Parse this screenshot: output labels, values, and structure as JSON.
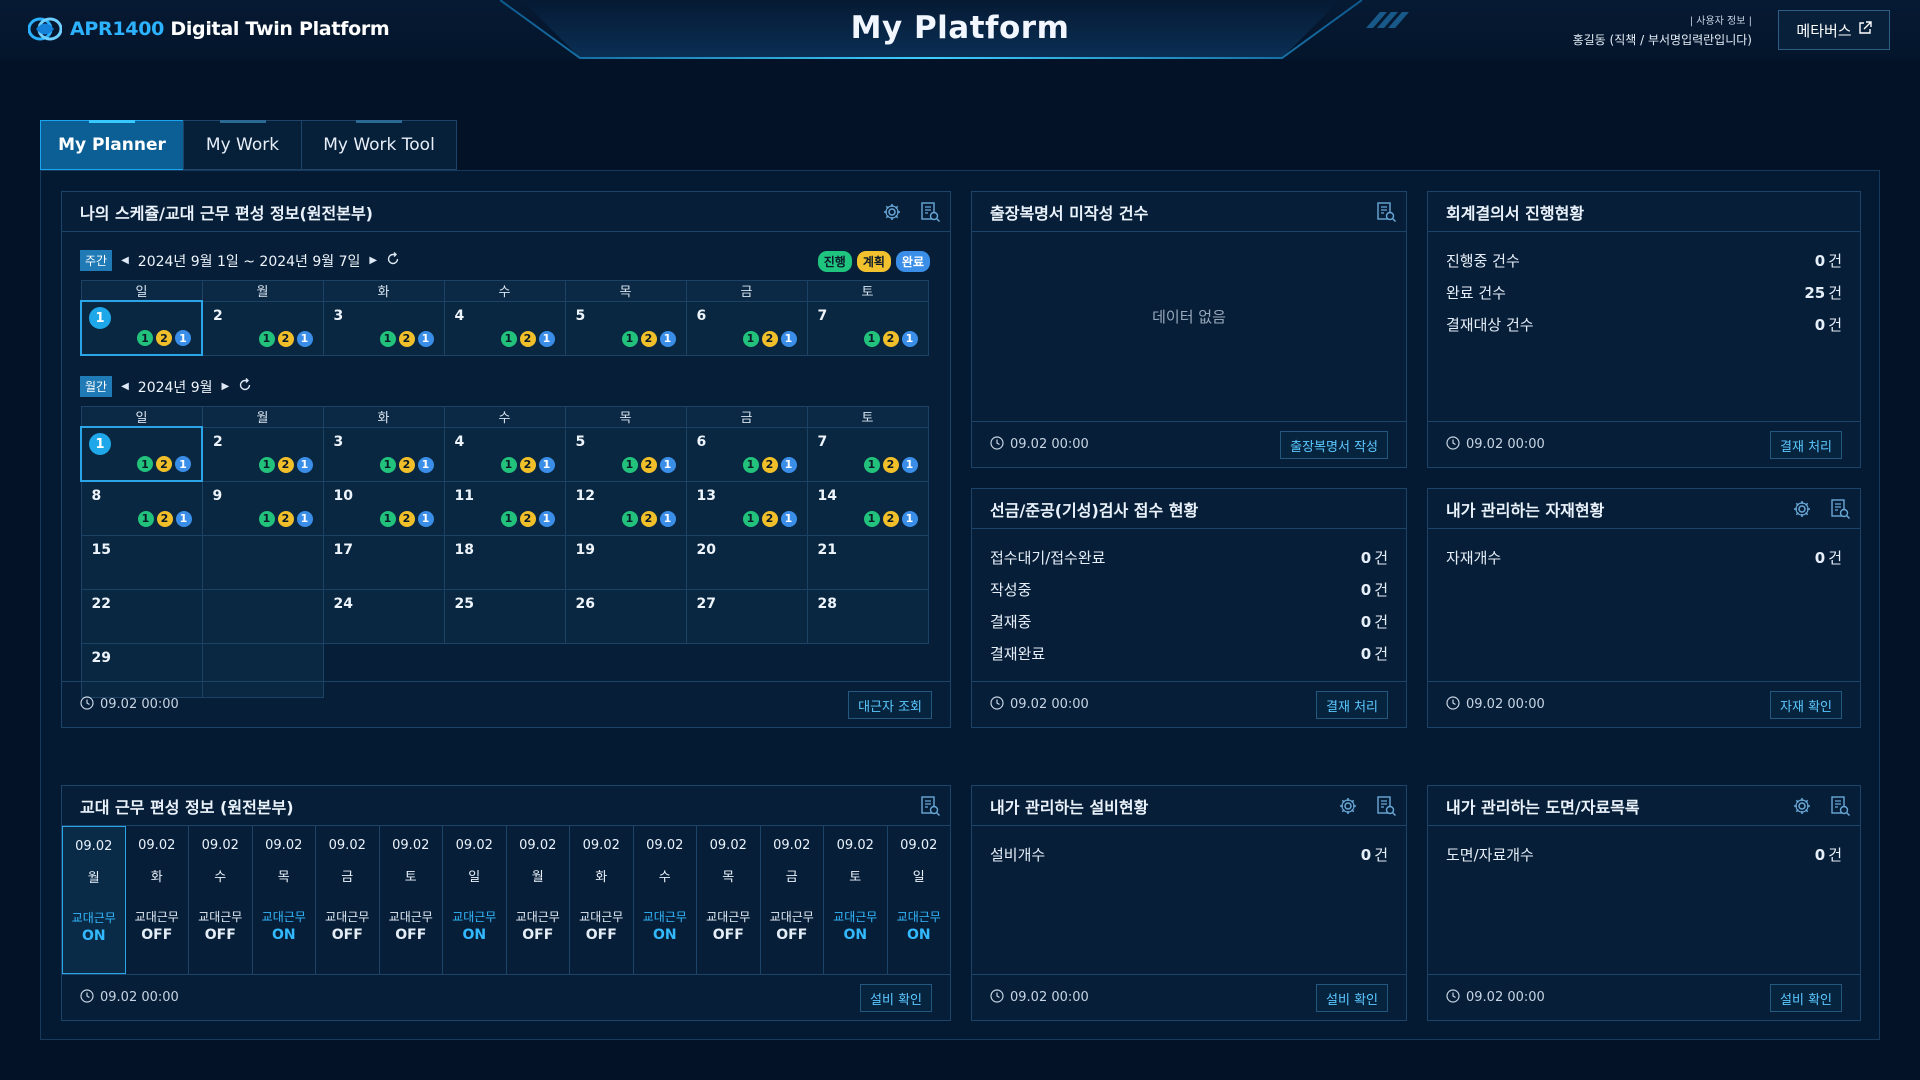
{
  "header": {
    "logo_brand": "APR1400",
    "logo_rest": " Digital Twin Platform",
    "title": "My Platform",
    "user_label": "| 사용자 정보 |",
    "user_name": "홍길동 (직책 / 부서명입력란입니다)",
    "metaverse_label": "메타버스"
  },
  "tabs": [
    {
      "label": "My Planner",
      "active": true
    },
    {
      "label": "My Work",
      "active": false
    },
    {
      "label": "My Work Tool",
      "active": false
    }
  ],
  "schedule": {
    "title": "나의 스케쥴/교대 근무 편성 정보(원전본부)",
    "weekly_tag": "주간",
    "weekly_range": "2024년 9월 1일 ~ 2024년 9월 7일",
    "monthly_tag": "월간",
    "monthly_range": "2024년 9월",
    "legend": [
      {
        "label": "진행",
        "color": "#1fc47f"
      },
      {
        "label": "계획",
        "color": "#f2c12e"
      },
      {
        "label": "완료",
        "color": "#3a8ee8"
      }
    ],
    "weekdays": [
      "일",
      "월",
      "화",
      "수",
      "목",
      "금",
      "토"
    ],
    "dot_labels": [
      "1",
      "2",
      "1"
    ],
    "dot_colors": [
      "#22c27c",
      "#f0bf2a",
      "#3a8ee8"
    ],
    "week_days": [
      "1",
      "2",
      "3",
      "4",
      "5",
      "6",
      "7"
    ],
    "month_rows": [
      [
        "1",
        "2",
        "3",
        "4",
        "5",
        "6",
        "7"
      ],
      [
        "8",
        "9",
        "10",
        "11",
        "12",
        "13",
        "14"
      ],
      [
        "15",
        "",
        "17",
        "18",
        "19",
        "20",
        "21"
      ],
      [
        "22",
        "",
        "24",
        "25",
        "26",
        "27",
        "28"
      ],
      [
        "29",
        ""
      ]
    ],
    "timestamp": "09.02 00:00",
    "button": "대근자 조회"
  },
  "trip": {
    "title": "출장복명서 미작성 건수",
    "empty": "데이터 없음",
    "timestamp": "09.02 00:00",
    "button": "출장복명서 작성"
  },
  "accounting": {
    "title": "회계결의서 진행현황",
    "rows": [
      {
        "label": "진행중 건수",
        "value": "0",
        "unit": "건"
      },
      {
        "label": "완료 건수",
        "value": "25",
        "unit": "건"
      },
      {
        "label": "결재대상 건수",
        "value": "0",
        "unit": "건"
      }
    ],
    "timestamp": "09.02 00:00",
    "button": "결재 처리"
  },
  "inspection": {
    "title": "선금/준공(기성)검사 접수 현황",
    "rows": [
      {
        "label": "접수대기/접수완료",
        "value": "0",
        "unit": "건"
      },
      {
        "label": "작성중",
        "value": "0",
        "unit": "건"
      },
      {
        "label": "결재중",
        "value": "0",
        "unit": "건"
      },
      {
        "label": "결재완료",
        "value": "0",
        "unit": "건"
      }
    ],
    "timestamp": "09.02 00:00",
    "button": "결재 처리"
  },
  "materials": {
    "title": "내가 관리하는 자재현황",
    "rows": [
      {
        "label": "자재개수",
        "value": "0",
        "unit": "건"
      }
    ],
    "timestamp": "09.02 00:00",
    "button": "자재 확인"
  },
  "shift": {
    "title": "교대 근무 편성 정보 (원전본부)",
    "label": "교대근무",
    "days": [
      {
        "date": "09.02",
        "dow": "월",
        "state": "ON"
      },
      {
        "date": "09.02",
        "dow": "화",
        "state": "OFF"
      },
      {
        "date": "09.02",
        "dow": "수",
        "state": "OFF"
      },
      {
        "date": "09.02",
        "dow": "목",
        "state": "ON"
      },
      {
        "date": "09.02",
        "dow": "금",
        "state": "OFF"
      },
      {
        "date": "09.02",
        "dow": "토",
        "state": "OFF"
      },
      {
        "date": "09.02",
        "dow": "일",
        "state": "ON"
      },
      {
        "date": "09.02",
        "dow": "월",
        "state": "OFF"
      },
      {
        "date": "09.02",
        "dow": "화",
        "state": "OFF"
      },
      {
        "date": "09.02",
        "dow": "수",
        "state": "ON"
      },
      {
        "date": "09.02",
        "dow": "목",
        "state": "OFF"
      },
      {
        "date": "09.02",
        "dow": "금",
        "state": "OFF"
      },
      {
        "date": "09.02",
        "dow": "토",
        "state": "ON"
      },
      {
        "date": "09.02",
        "dow": "일",
        "state": "ON"
      }
    ],
    "timestamp": "09.02 00:00",
    "button": "설비 확인"
  },
  "equipment": {
    "title": "내가 관리하는 설비현황",
    "rows": [
      {
        "label": "설비개수",
        "value": "0",
        "unit": "건"
      }
    ],
    "timestamp": "09.02 00:00",
    "button": "설비 확인"
  },
  "drawings": {
    "title": "내가 관리하는 도면/자료목록",
    "rows": [
      {
        "label": "도면/자료개수",
        "value": "0",
        "unit": "건"
      }
    ],
    "timestamp": "09.02 00:00",
    "button": "설비 확인"
  }
}
